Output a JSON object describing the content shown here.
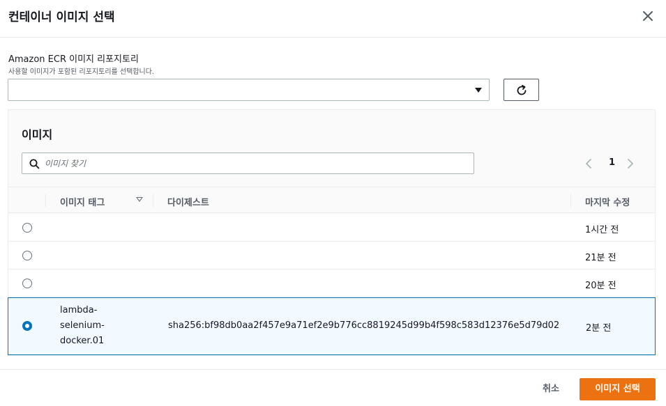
{
  "modal": {
    "title": "컨테이너 이미지 선택"
  },
  "repository": {
    "label": "Amazon ECR 이미지 리포지토리",
    "description": "사용할 이미지가 포함된 리포지토리를 선택합니다.",
    "selected_value": ""
  },
  "images": {
    "title": "이미지",
    "search_placeholder": "이미지 찾기",
    "page": "1",
    "columns": {
      "tag": "이미지 태그",
      "digest": "다이제스트",
      "modified": "마지막 수정"
    },
    "rows": [
      {
        "tag": "",
        "digest": "",
        "modified": "1시간 전",
        "selected": false
      },
      {
        "tag": "",
        "digest": "",
        "modified": "21분 전",
        "selected": false
      },
      {
        "tag": "",
        "digest": "",
        "modified": "20분 전",
        "selected": false
      },
      {
        "tag_lines": [
          "lambda-",
          "selenium-",
          "docker.01"
        ],
        "digest": "sha256:bf98db0aa2f457e9a71ef2e9b776cc8819245d99b4f598c583d12376e5d79d02",
        "modified": "2분 전",
        "selected": true
      }
    ]
  },
  "footer": {
    "cancel_label": "취소",
    "confirm_label": "이미지 선택"
  },
  "colors": {
    "accent": "#ec7211",
    "selection_blue": "#0073bb"
  },
  "icons": [
    "close-icon",
    "caret-down-icon",
    "refresh-icon",
    "search-icon",
    "chevron-left-icon",
    "chevron-right-icon",
    "sort-icon"
  ]
}
